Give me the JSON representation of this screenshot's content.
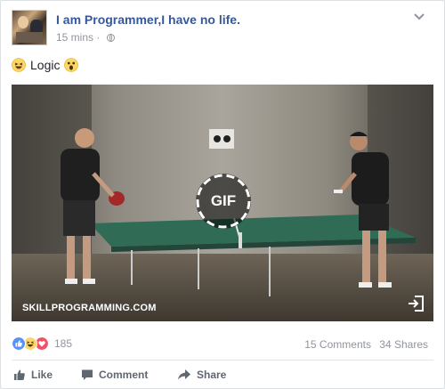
{
  "post": {
    "page_name": "I am Programmer,I have no life.",
    "time": "15 mins",
    "separator": "·",
    "text": "Logic",
    "icons": {
      "avatar": "page-avatar",
      "privacy": "globe-icon",
      "options": "chevron-down-icon",
      "emoji_before": "laughing-emoji-icon",
      "emoji_after": "surprised-emoji-icon"
    }
  },
  "media": {
    "gif_label": "GIF",
    "watermark": "SKILLPROGRAMMING.COM",
    "expand_icon": "expand-icon"
  },
  "stats": {
    "reaction_count": "185",
    "comments": "15 Comments",
    "shares": "34 Shares",
    "reaction_icons": [
      "like-icon",
      "haha-icon",
      "love-icon"
    ]
  },
  "actions": {
    "like": "Like",
    "comment": "Comment",
    "share": "Share"
  },
  "colors": {
    "link": "#365899",
    "meta": "#90949c",
    "like_blue": "#5890ff",
    "love_red": "#f25268",
    "haha_yellow": "#fcd669"
  }
}
